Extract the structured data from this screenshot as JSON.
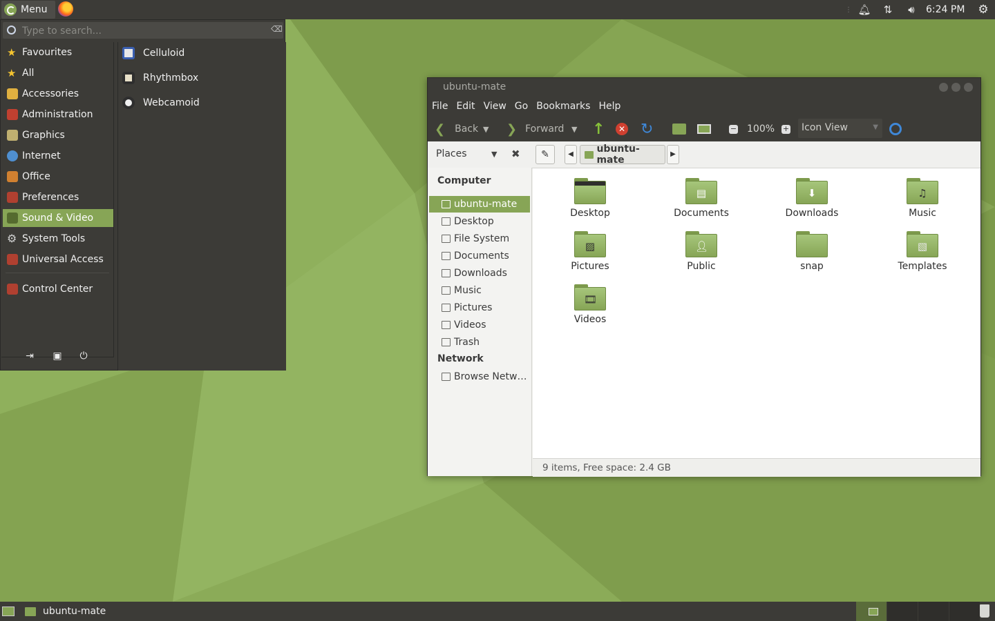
{
  "top_panel": {
    "menu_label": "Menu",
    "clock": "6:24 PM",
    "tray_icons": [
      "notification-bell-icon",
      "network-arrows-icon",
      "volume-icon",
      "settings-gear-icon"
    ]
  },
  "app_menu": {
    "search_placeholder": "Type to search...",
    "categories": [
      {
        "label": "Favourites",
        "icon": "star-icon",
        "color": "#f4c430"
      },
      {
        "label": "All",
        "icon": "star-icon",
        "color": "#f4c430"
      },
      {
        "label": "Accessories",
        "icon": "accessories-icon",
        "color": "#e0b040"
      },
      {
        "label": "Administration",
        "icon": "administration-icon",
        "color": "#c04030"
      },
      {
        "label": "Graphics",
        "icon": "graphics-icon",
        "color": "#c0b070"
      },
      {
        "label": "Internet",
        "icon": "globe-icon",
        "color": "#4f8fd0"
      },
      {
        "label": "Office",
        "icon": "office-icon",
        "color": "#d08030"
      },
      {
        "label": "Preferences",
        "icon": "preferences-icon",
        "color": "#b04030"
      },
      {
        "label": "Sound & Video",
        "icon": "sound-video-icon",
        "color": "#556b2f"
      },
      {
        "label": "System Tools",
        "icon": "gear-icon",
        "color": "#cfcfcf"
      },
      {
        "label": "Universal Access",
        "icon": "universal-access-icon",
        "color": "#b04030"
      },
      {
        "label": "Control Center",
        "icon": "control-center-icon",
        "color": "#b04030"
      }
    ],
    "selected_category": "Sound & Video",
    "apps": [
      {
        "label": "Celluloid",
        "icon": "celluloid-icon",
        "color": "#3a5fb0"
      },
      {
        "label": "Rhythmbox",
        "icon": "rhythmbox-icon",
        "color": "#e8e0c8"
      },
      {
        "label": "Webcamoid",
        "icon": "webcamoid-icon",
        "color": "#f0f0f0"
      }
    ]
  },
  "file_manager": {
    "title": "ubuntu-mate",
    "menus": [
      "File",
      "Edit",
      "View",
      "Go",
      "Bookmarks",
      "Help"
    ],
    "toolbar": {
      "back": "Back",
      "forward": "Forward",
      "zoom": "100%",
      "view_mode": "Icon View"
    },
    "sidebar_mode": "Places",
    "path": "ubuntu-mate",
    "sidebar": {
      "computer_header": "Computer",
      "computer_items": [
        "ubuntu-mate",
        "Desktop",
        "File System",
        "Documents",
        "Downloads",
        "Music",
        "Pictures",
        "Videos",
        "Trash"
      ],
      "network_header": "Network",
      "network_items": [
        "Browse Netw…"
      ]
    },
    "files": [
      {
        "label": "Desktop",
        "icon": "desktop-folder-icon"
      },
      {
        "label": "Documents",
        "icon": "documents-folder-icon"
      },
      {
        "label": "Downloads",
        "icon": "downloads-folder-icon"
      },
      {
        "label": "Music",
        "icon": "music-folder-icon"
      },
      {
        "label": "Pictures",
        "icon": "pictures-folder-icon"
      },
      {
        "label": "Public",
        "icon": "public-folder-icon"
      },
      {
        "label": "snap",
        "icon": "folder-icon"
      },
      {
        "label": "Templates",
        "icon": "templates-folder-icon"
      },
      {
        "label": "Videos",
        "icon": "videos-folder-icon"
      }
    ],
    "status": "9 items, Free space: 2.4 GB"
  },
  "bottom_panel": {
    "task_label": "ubuntu-mate"
  },
  "colors": {
    "accent": "#87a556",
    "panel": "#3c3b37",
    "wallpaper": "#87a556"
  }
}
